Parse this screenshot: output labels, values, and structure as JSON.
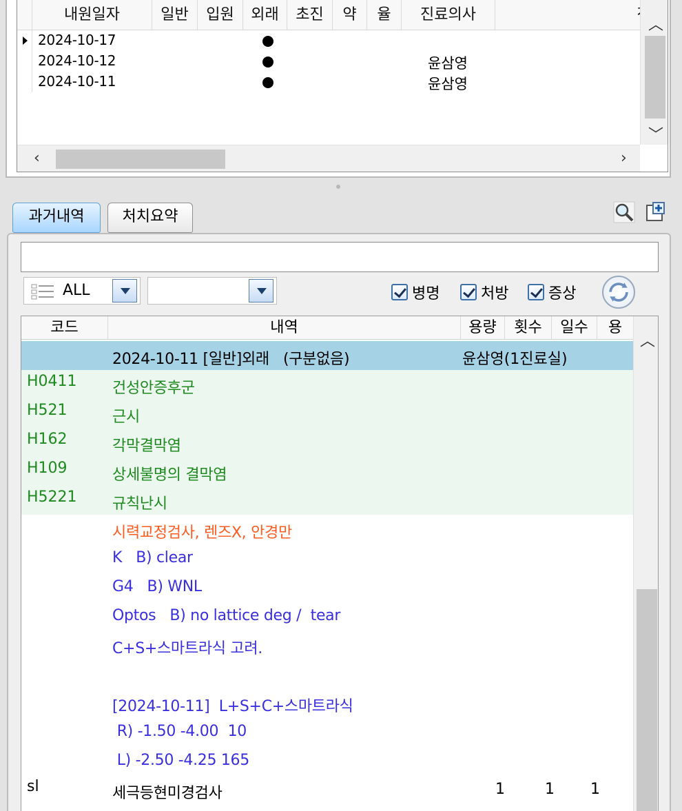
{
  "visits": {
    "columns": [
      "내원일자",
      "일반",
      "입원",
      "외래",
      "초진",
      "약",
      "율",
      "진료의사",
      "전달"
    ],
    "rows": [
      {
        "date": "2024-10-17",
        "outpatient": true,
        "doctor": "",
        "selected": true
      },
      {
        "date": "2024-10-12",
        "outpatient": true,
        "doctor": "윤삼영",
        "selected": false
      },
      {
        "date": "2024-10-11",
        "outpatient": true,
        "doctor": "윤삼영",
        "selected": false
      }
    ]
  },
  "tabs": [
    {
      "label": "과거내역",
      "active": true
    },
    {
      "label": "처치요약",
      "active": false
    }
  ],
  "filters": {
    "type_combo": "ALL",
    "second_combo": "",
    "checkboxes": [
      {
        "label": "병명",
        "checked": true
      },
      {
        "label": "처방",
        "checked": true
      },
      {
        "label": "증상",
        "checked": true
      }
    ]
  },
  "history": {
    "columns": [
      "코드",
      "내역",
      "용량",
      "횟수",
      "일수",
      "용"
    ],
    "header_row": {
      "desc": "2024-10-11 [일반]외래   (구분없음)",
      "doctor": "윤삼영(1진료실)"
    },
    "diagnoses": [
      {
        "code": "H0411",
        "desc": "건성안증후군"
      },
      {
        "code": "H521",
        "desc": "근시"
      },
      {
        "code": "H162",
        "desc": "각막결막염"
      },
      {
        "code": "H109",
        "desc": "상세불명의 결막염"
      },
      {
        "code": "H5221",
        "desc": "규칙난시"
      }
    ],
    "exam_orange": "시력교정검사, 렌즈X, 안경만",
    "notes": [
      "K   B) clear",
      "G4   B) WNL",
      "Optos   B) no lattice deg /  tear",
      "C+S+스마트라식 고려.",
      "",
      "[2024-10-11]  L+S+C+스마트라식",
      " R) -1.50 -4.00  10",
      " L) -2.50 -4.25 165"
    ],
    "last_row": {
      "code": "sl",
      "desc": "세극등현미경검사",
      "qty": "1",
      "times": "1",
      "days": "1"
    }
  },
  "colors": {
    "diagnosis_green": "#1f8a1f",
    "diagnosis_bg": "#ebf7ef",
    "header_row_bg": "#a6d2e6",
    "orange": "#ff5a1f",
    "note_blue": "#3a2fe0"
  }
}
